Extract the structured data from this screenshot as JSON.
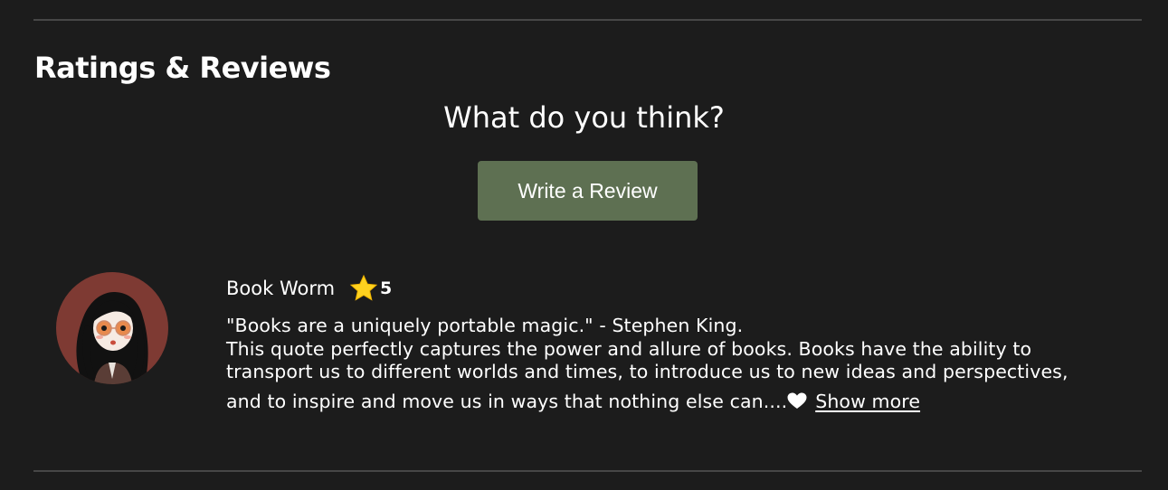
{
  "section": {
    "title": "Ratings & Reviews",
    "prompt": "What do you think?",
    "write_review_label": "Write a Review"
  },
  "review": {
    "reviewer_name": "Book Worm",
    "rating": "5",
    "rating_icon": "star-icon",
    "quote_line": "\"Books are a uniquely portable magic.\" - Stephen King.",
    "body": "This quote perfectly captures the power and allure of books. Books have the ability to transport us to different worlds and times, to introduce us to new ideas and perspectives,",
    "last_line": "and to inspire and move us in ways that nothing else can....",
    "end_icon": "heart-icon",
    "show_more_label": "Show more"
  },
  "colors": {
    "background": "#1c1c1c",
    "button": "#5e7052",
    "divider": "#474747",
    "star": "#ffd21f",
    "avatar_bg": "#7e3a33"
  }
}
